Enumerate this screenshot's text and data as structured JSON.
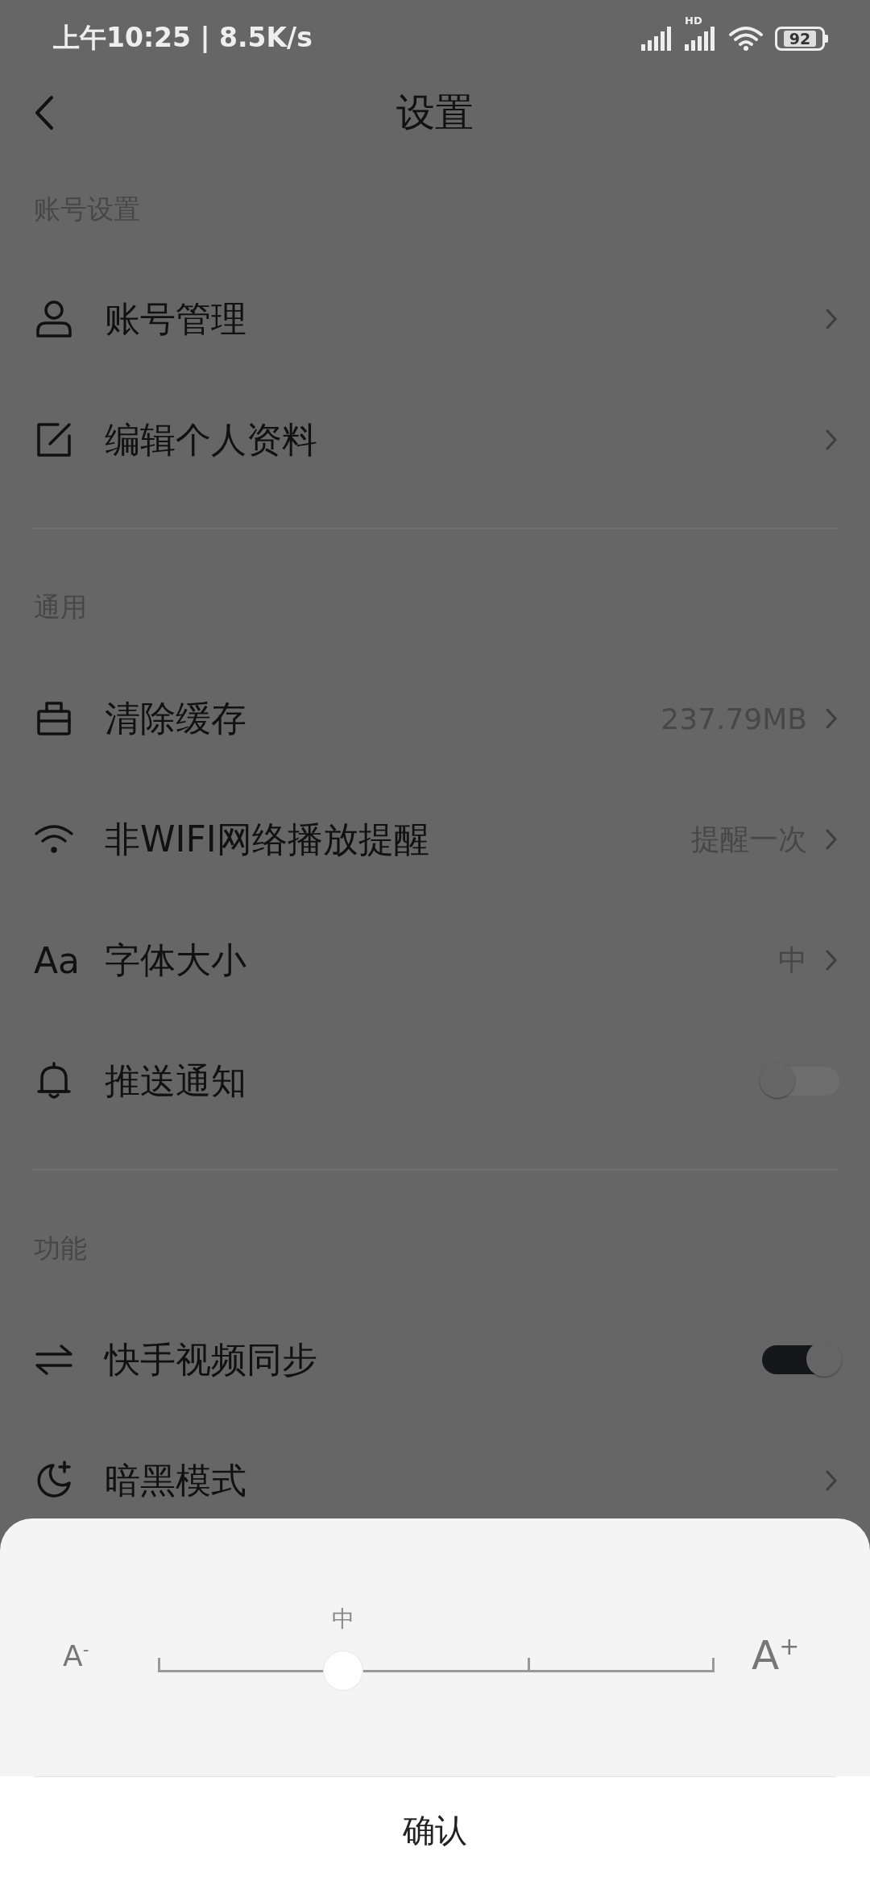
{
  "status_bar": {
    "time": "上午10:25 | 8.5K/s",
    "hd": "HD",
    "battery": "92"
  },
  "header": {
    "title": "设置"
  },
  "sections": [
    {
      "title": "账号设置",
      "rows": [
        {
          "kind": "link",
          "label": "账号管理"
        },
        {
          "kind": "link",
          "label": "编辑个人资料"
        }
      ]
    },
    {
      "title": "通用",
      "rows": [
        {
          "kind": "link",
          "label": "清除缓存",
          "value": "237.79MB"
        },
        {
          "kind": "link",
          "label": "非WIFI网络播放提醒",
          "value": "提醒一次"
        },
        {
          "kind": "link",
          "glyph": "Aa",
          "label": "字体大小",
          "value": "中"
        },
        {
          "kind": "toggle",
          "label": "推送通知",
          "on": false
        }
      ]
    },
    {
      "title": "功能",
      "rows": [
        {
          "kind": "toggle",
          "label": "快手视频同步",
          "on": true
        },
        {
          "kind": "link",
          "label": "暗黑模式"
        }
      ]
    }
  ],
  "font_sheet": {
    "smaller": "A$^{-}$",
    "larger": "A$^{+}$",
    "slider": {
      "label": "中",
      "level": 0.333
    },
    "confirm": "确认"
  }
}
